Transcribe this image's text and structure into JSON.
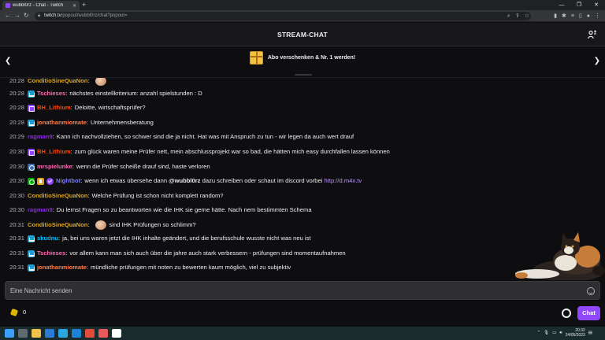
{
  "browser": {
    "tab_title": "wubbl0rz - Chat - Twitch",
    "url_host": "twitch.tv",
    "url_path": "/popout/wubbl0rz/chat?popout="
  },
  "header": {
    "title": "STREAM-CHAT"
  },
  "promo": {
    "text": "Abo verschenken & Nr. 1 werden!"
  },
  "messages": [
    {
      "time": "20:28",
      "badges": [],
      "user": "ConditioSineQuaNon",
      "color": "#daa520",
      "text": "",
      "emote": true
    },
    {
      "time": "20:28",
      "badges": [
        "sub"
      ],
      "user": "Tschieses",
      "color": "#ff69b4",
      "text": "nächstes einstellkriterium: anzahl spielstunden : D"
    },
    {
      "time": "20:28",
      "badges": [
        "prime"
      ],
      "user": "BH_Lithium",
      "color": "#ff4500",
      "text": "Deloitte, wirtschaftsprüfer?"
    },
    {
      "time": "20:28",
      "badges": [
        "sub"
      ],
      "user": "jonathanmiomate",
      "color": "#ff7f50",
      "text": "Unternehmensberatung"
    },
    {
      "time": "20:29",
      "badges": [],
      "user": "ragman9",
      "color": "#8a2be2",
      "text": "Kann ich nachvollziehen, so schwer sind die ja nicht. Hat was mit Anspruch zu tun - wir legen da auch wert drauf"
    },
    {
      "time": "20:30",
      "badges": [
        "prime"
      ],
      "user": "BH_Lithium",
      "color": "#ff4500",
      "text": "zum glück waren meine Prüfer nett, mein abschlussprojekt war so bad, die hätten mich easy durchfallen lassen können"
    },
    {
      "time": "20:30",
      "badges": [
        "partner"
      ],
      "user": "mrspielunke",
      "color": "#ff69b4",
      "text": "wenn die Prüfer scheiße drauf sind, haste verloren"
    },
    {
      "time": "20:30",
      "badges": [
        "mod",
        "gold",
        "verified"
      ],
      "user": "Nightbot",
      "color": "#7c7cff",
      "text": "wenn ich etwas übersehe dann ",
      "mention": "@wubbl0rz",
      "text2": " dazu schreiben oder schaut im discord vorbei ",
      "link": "http://d.m4x.tv"
    },
    {
      "time": "20:30",
      "badges": [],
      "user": "ConditioSineQuaNon",
      "color": "#daa520",
      "text": "Welche Prüfung ist schon nicht komplett random?"
    },
    {
      "time": "20:30",
      "badges": [],
      "user": "ragman9",
      "color": "#8a2be2",
      "text": "Du lernst Fragen so zu beantworten wie die IHK sie gerne hätte. Nach nem bestimmten Schema"
    },
    {
      "time": "20:31",
      "badges": [],
      "user": "ConditioSineQuaNon",
      "color": "#daa520",
      "text": "sind IHK Prüfungen so schlimm?",
      "emote_before": true
    },
    {
      "time": "20:31",
      "badges": [
        "sub"
      ],
      "user": "skudnu",
      "color": "#00bfff",
      "text": "ja, bei uns waren jetzt die IHK inhalte geändert, und die berufsschule wusste nicht was neu ist"
    },
    {
      "time": "20:31",
      "badges": [
        "sub"
      ],
      "user": "Tschieses",
      "color": "#ff69b4",
      "text": "vor allem kann man sich auch über die jahre auch stark verbessern - prüfungen sind momentaufnahmen"
    },
    {
      "time": "20:31",
      "badges": [
        "sub"
      ],
      "user": "jonathanmiomate",
      "color": "#ff7f50",
      "text": "mündliche prüfungen mit noten zu bewerten kaum möglich, viel zu subjektiv"
    }
  ],
  "input": {
    "placeholder": "Eine Nachricht senden"
  },
  "footer": {
    "points": "0",
    "chat_button": "Chat"
  },
  "taskbar": {
    "time": "20:32",
    "date": "24/05/2023"
  }
}
